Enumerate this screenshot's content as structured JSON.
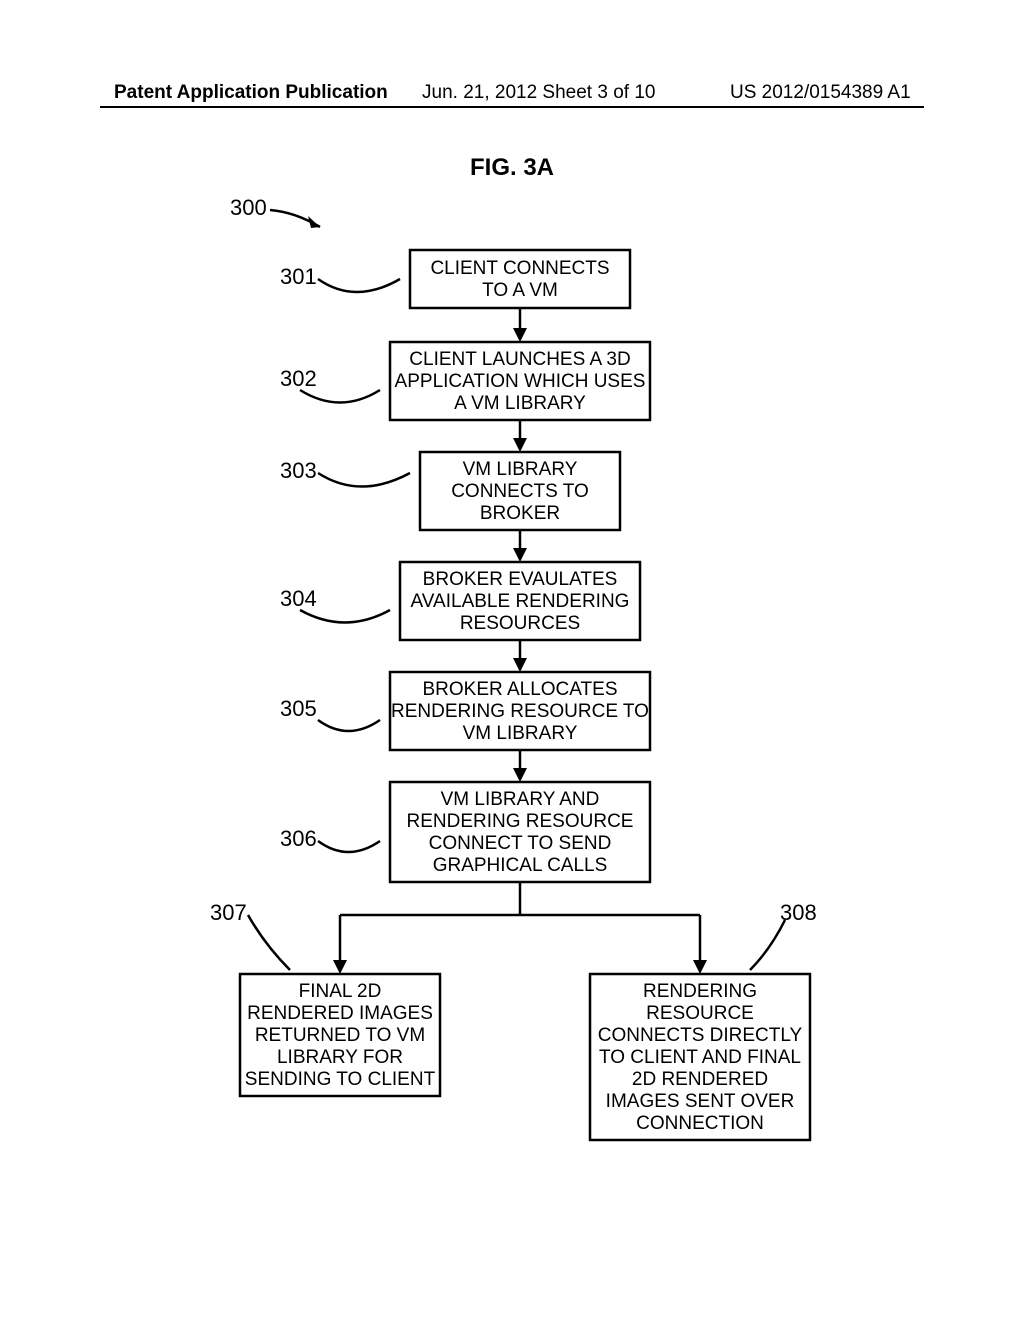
{
  "header": {
    "left": "Patent Application Publication",
    "center": "Jun. 21, 2012  Sheet 3 of 10",
    "right": "US 2012/0154389 A1"
  },
  "figure_title": "FIG. 3A",
  "chart_data": {
    "type": "flowchart",
    "reference_label": "300",
    "nodes": [
      {
        "id": "301",
        "text": [
          "CLIENT CONNECTS",
          "TO A VM"
        ]
      },
      {
        "id": "302",
        "text": [
          "CLIENT LAUNCHES A 3D",
          "APPLICATION WHICH USES",
          "A VM LIBRARY"
        ]
      },
      {
        "id": "303",
        "text": [
          "VM LIBRARY",
          "CONNECTS TO",
          "BROKER"
        ]
      },
      {
        "id": "304",
        "text": [
          "BROKER EVAULATES",
          "AVAILABLE RENDERING",
          "RESOURCES"
        ]
      },
      {
        "id": "305",
        "text": [
          "BROKER ALLOCATES",
          "RENDERING RESOURCE TO",
          "VM LIBRARY"
        ]
      },
      {
        "id": "306",
        "text": [
          "VM LIBRARY AND",
          "RENDERING RESOURCE",
          "CONNECT TO SEND",
          "GRAPHICAL CALLS"
        ]
      },
      {
        "id": "307",
        "text": [
          "FINAL 2D",
          "RENDERED IMAGES",
          "RETURNED TO VM",
          "LIBRARY FOR",
          "SENDING TO CLIENT"
        ]
      },
      {
        "id": "308",
        "text": [
          "RENDERING",
          "RESOURCE",
          "CONNECTS DIRECTLY",
          "TO CLIENT AND FINAL",
          "2D RENDERED",
          "IMAGES SENT OVER",
          "CONNECTION"
        ]
      }
    ],
    "edges": [
      {
        "from": "301",
        "to": "302"
      },
      {
        "from": "302",
        "to": "303"
      },
      {
        "from": "303",
        "to": "304"
      },
      {
        "from": "304",
        "to": "305"
      },
      {
        "from": "305",
        "to": "306"
      },
      {
        "from": "306",
        "to": "307"
      },
      {
        "from": "306",
        "to": "308"
      }
    ]
  }
}
